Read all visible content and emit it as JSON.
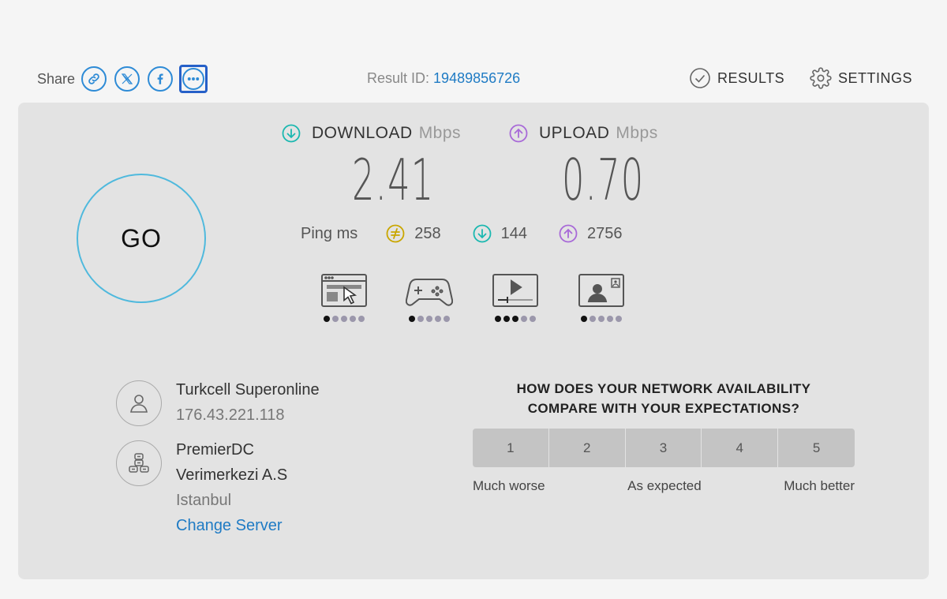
{
  "share": {
    "label": "Share",
    "buttons": [
      {
        "icon": "link-icon"
      },
      {
        "icon": "x-logo-icon"
      },
      {
        "icon": "facebook-icon"
      },
      {
        "icon": "more-icon"
      }
    ]
  },
  "result": {
    "label": "Result ID:",
    "id": "19489856726"
  },
  "nav": {
    "results": "RESULTS",
    "settings": "SETTINGS"
  },
  "go": {
    "label": "GO"
  },
  "download": {
    "label": "DOWNLOAD",
    "unit": "Mbps",
    "value": "2.41",
    "color": "#1bb8b0"
  },
  "upload": {
    "label": "UPLOAD",
    "unit": "Mbps",
    "value": "0.70",
    "color": "#a86ad8"
  },
  "ping": {
    "label": "Ping ms",
    "idle": "258",
    "download": "144",
    "upload": "2756",
    "idle_color": "#c9a600"
  },
  "usage": [
    {
      "icon": "web-browsing-icon",
      "level": 1,
      "max": 5
    },
    {
      "icon": "gaming-icon",
      "level": 1,
      "max": 5
    },
    {
      "icon": "video-streaming-icon",
      "level": 3,
      "max": 5
    },
    {
      "icon": "video-call-icon",
      "level": 1,
      "max": 5
    }
  ],
  "isp": {
    "name": "Turkcell Superonline",
    "ip": "176.43.221.118"
  },
  "server": {
    "name_line1": "PremierDC",
    "name_line2": "Verimerkezi A.S",
    "city": "Istanbul",
    "change": "Change Server"
  },
  "survey": {
    "question_line1": "HOW DOES YOUR NETWORK AVAILABILITY",
    "question_line2": "COMPARE WITH YOUR EXPECTATIONS?",
    "options": [
      "1",
      "2",
      "3",
      "4",
      "5"
    ],
    "scale_low": "Much worse",
    "scale_mid": "As expected",
    "scale_high": "Much better"
  }
}
